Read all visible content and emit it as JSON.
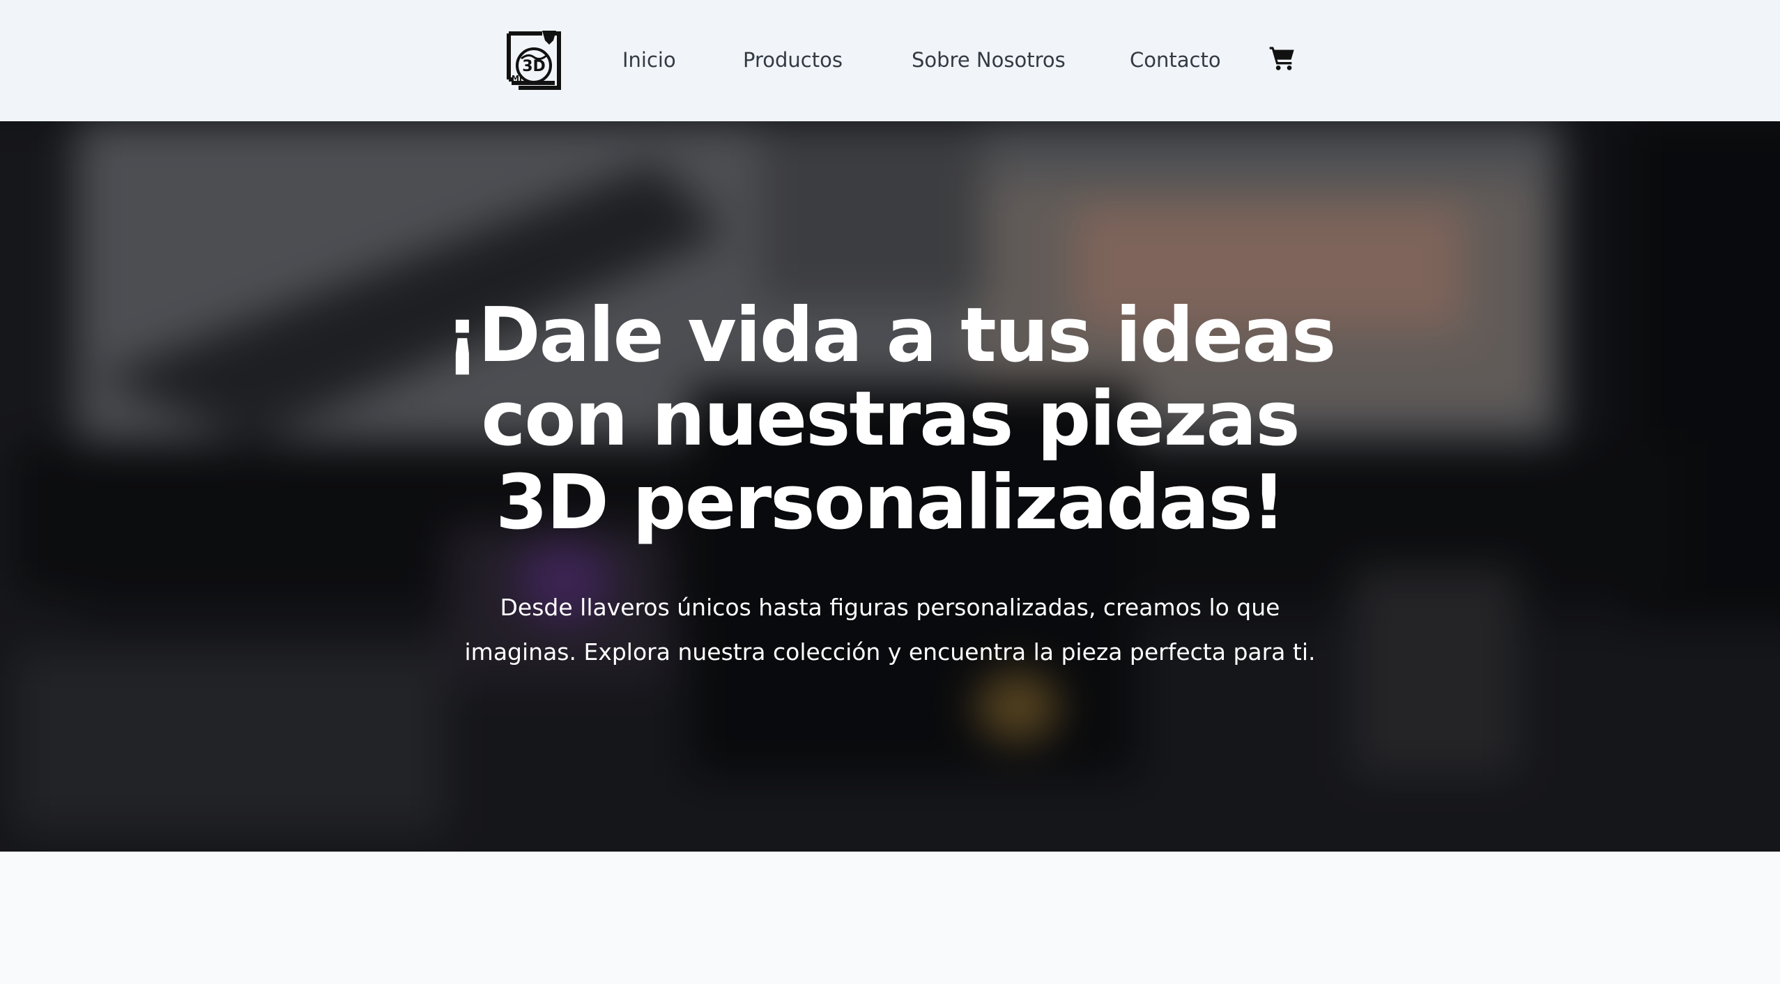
{
  "navbar": {
    "logo_icon": "3d-printer-globe-logo",
    "links": [
      {
        "label": "Inicio"
      },
      {
        "label": "Productos"
      },
      {
        "label": "Sobre Nosotros"
      },
      {
        "label": "Contacto"
      }
    ],
    "cart_icon": "shopping-cart-icon"
  },
  "hero": {
    "title_line1": "¡Dale vida a tus ideas",
    "title_line2": "con nuestras piezas",
    "title_line3": "3D personalizadas!",
    "subtitle_line1": "Desde llaveros únicos hasta figuras personalizadas, creamos lo que",
    "subtitle_line2": "imaginas. Explora nuestra colección y encuentra la pieza perfecta para ti."
  },
  "colors": {
    "navbar_bg": "#f1f5f9",
    "nav_text": "#333a44",
    "hero_text": "#ffffff",
    "page_bg": "#f8fafc"
  }
}
